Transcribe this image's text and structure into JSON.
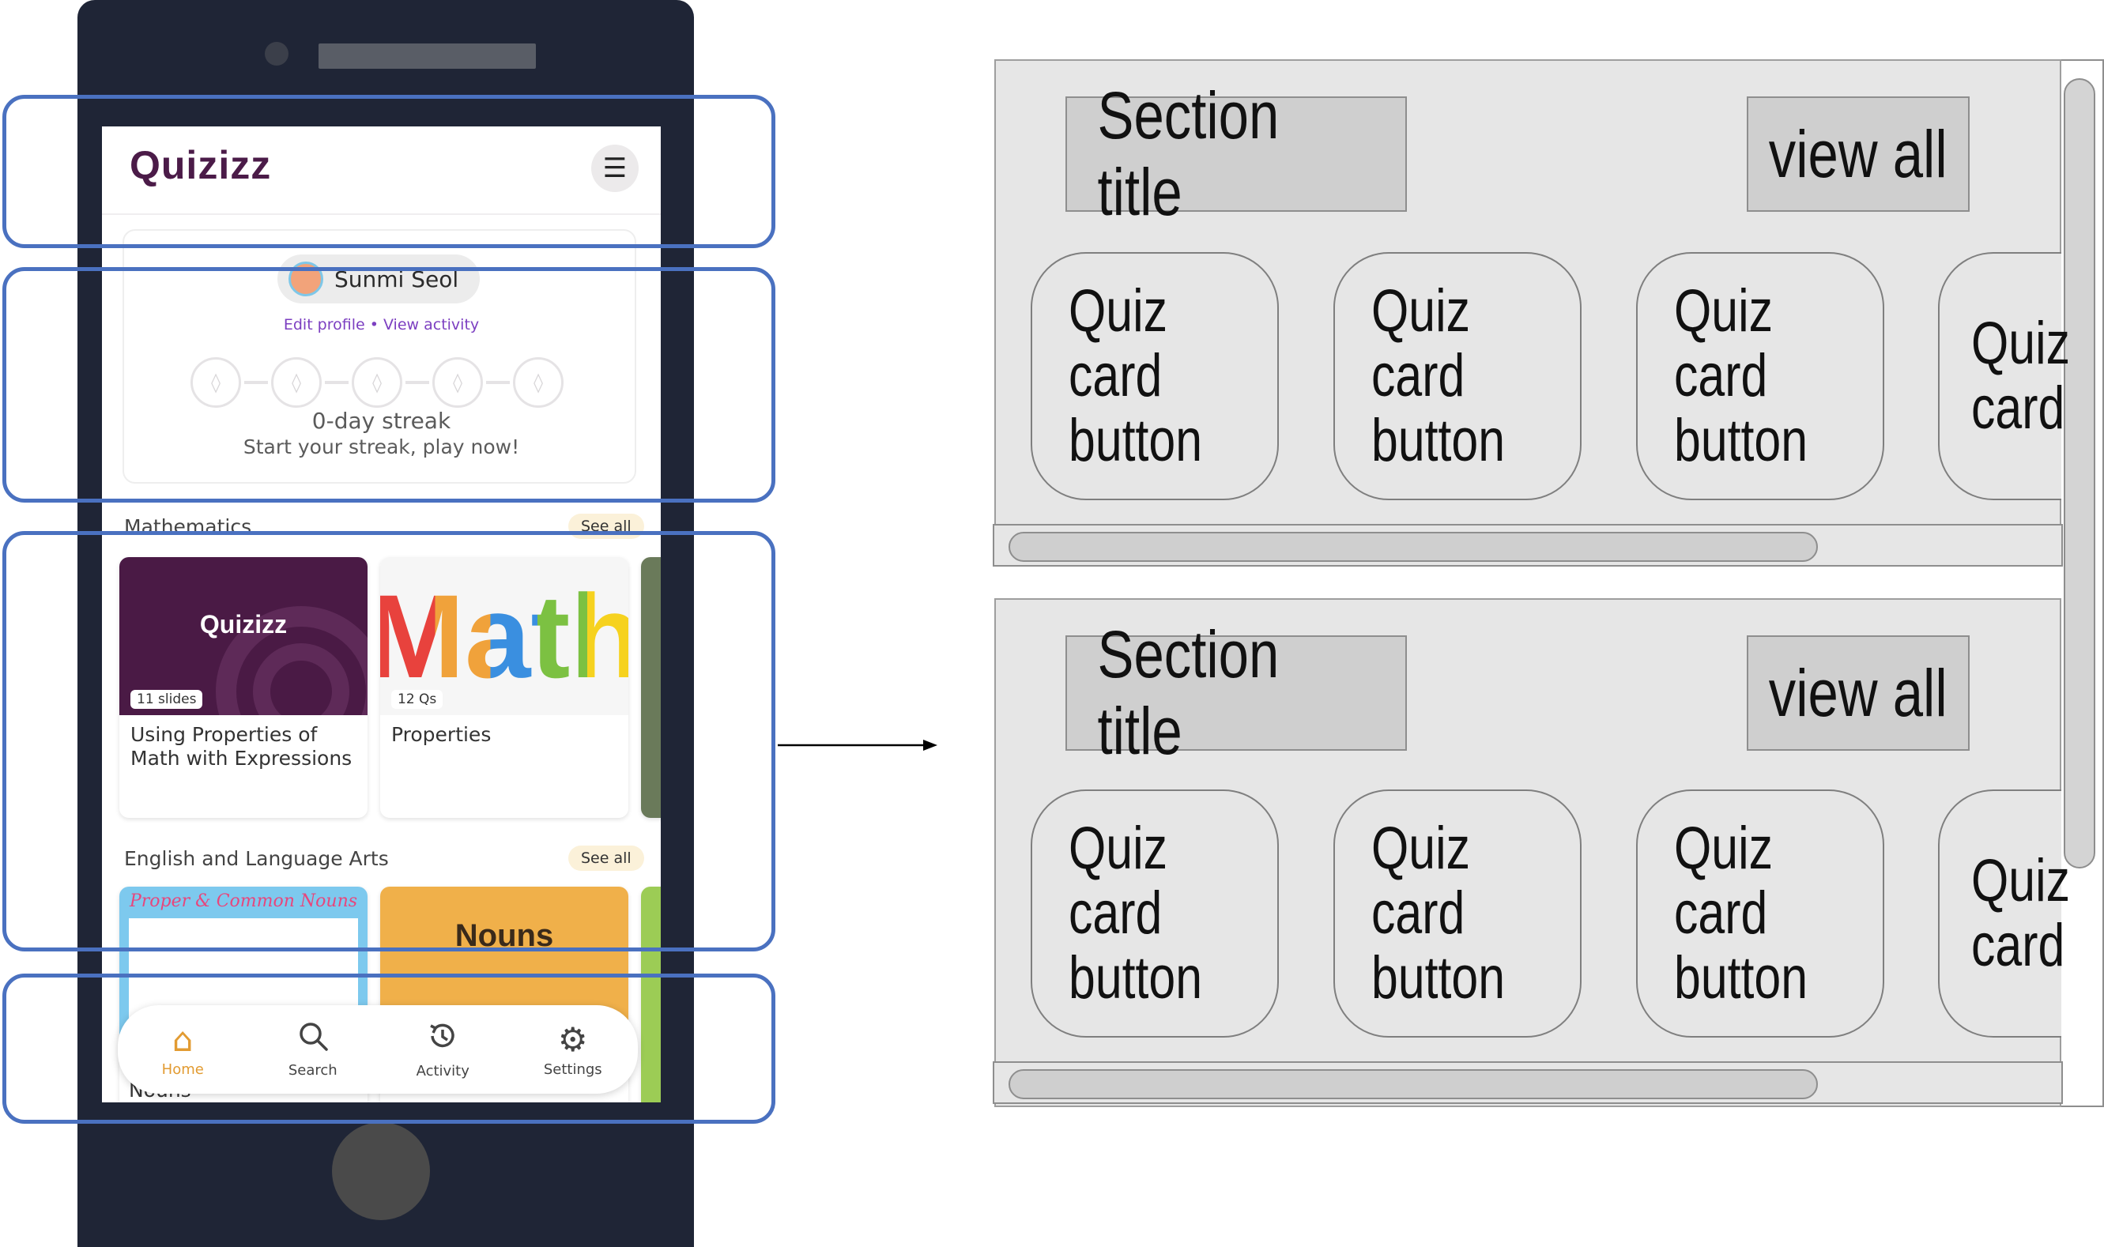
{
  "app": {
    "logo_text": "Quizizz",
    "menu_icon": "hamburger-menu-icon"
  },
  "profile": {
    "name": "Sunmi Seol",
    "links": "Edit profile  •  View activity",
    "streak_days": 5,
    "streak_count": "0-day streak",
    "streak_message": "Start your streak, play now!"
  },
  "sections": [
    {
      "title": "Mathematics",
      "see_all": "See all",
      "cards": [
        {
          "thumb_text": "Quizizz",
          "badge": "11 slides",
          "title": "Using Properties of Math with Expressions",
          "thumb_color": "#4a1a45"
        },
        {
          "thumb_text": "Math",
          "badge": "12 Qs",
          "title": "Properties",
          "thumb_color": "#f6f6f6"
        }
      ]
    },
    {
      "title": "English and Language Arts",
      "see_all": "See all",
      "cards": [
        {
          "thumb_text": "Proper & Common Nouns",
          "thumb_color": "#7dc9ee"
        },
        {
          "thumb_text": "Nouns",
          "thumb_color": "#f0b04a"
        }
      ],
      "partial_label": "Nouns"
    }
  ],
  "bottom_nav": [
    {
      "label": "Home",
      "icon": "home-icon",
      "active": true
    },
    {
      "label": "Search",
      "icon": "search-icon",
      "active": false
    },
    {
      "label": "Activity",
      "icon": "history-icon",
      "active": false
    },
    {
      "label": "Settings",
      "icon": "gear-icon",
      "active": false
    }
  ],
  "wireframe": {
    "sections": [
      {
        "title": "Section title",
        "view_all": "view all",
        "cards": [
          "Quiz card button",
          "Quiz card button",
          "Quiz card button"
        ],
        "partial_card": "Quiz card"
      },
      {
        "title": "Section title",
        "view_all": "view all",
        "cards": [
          "Quiz card button",
          "Quiz card button",
          "Quiz card button"
        ],
        "partial_card": "Quiz card"
      }
    ]
  },
  "colors": {
    "phone_body": "#1f2536",
    "highlight_border": "#4a71c0",
    "brand_purple": "#4b1b48",
    "link_purple": "#7c3fc1",
    "nav_active": "#e29b32",
    "wireframe_fill": "#e6e6e6",
    "wireframe_box": "#cfcfcf"
  }
}
